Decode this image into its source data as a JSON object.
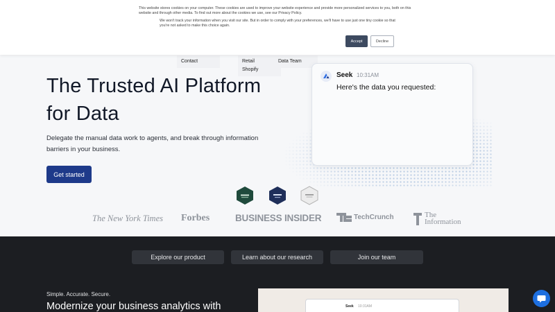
{
  "cookie": {
    "text1": "This website stores cookies on your computer. These cookies are used to improve your website experience and provide more personalized services to you, both on this website and through other media. To find out more about the cookies we use, see our Privacy Policy.",
    "text2": "We won't track your information when you visit our site. But in order to comply with your preferences, we'll have to use just one tiny cookie so that you're not asked to make this choice again.",
    "accept": "Accept",
    "decline": "Decline"
  },
  "nav_dropdowns": {
    "contact": "Contact",
    "retail": "Retail",
    "shopify": "Shopify",
    "data_team": "Data Team"
  },
  "hero": {
    "title_line1": "The Trusted AI Platform",
    "title_line2": "for Data",
    "subtitle": "Delegate the manual data work to agents, and break through information barriers in your business.",
    "cta": "Get started"
  },
  "chat": {
    "name": "Seek",
    "time": "10:31AM",
    "message": "Here's the data you requested:"
  },
  "badges": [
    {
      "icon": "g2-award-badge",
      "color": "#1f4a3c"
    },
    {
      "icon": "gartner-badge",
      "color": "#1f2f5a"
    },
    {
      "icon": "award-badge",
      "color": "#e8e8e8"
    }
  ],
  "press_logos": {
    "nyt": "The New York Times",
    "forbes": "Forbes",
    "business_insider": "BUSINESS INSIDER",
    "techcrunch": "TechCrunch",
    "the_information_line1": "The",
    "the_information_line2": "Information"
  },
  "dark_section": {
    "buttons": [
      "Explore our product",
      "Learn about our research",
      "Join our team"
    ],
    "kicker": "Simple. Accurate. Secure.",
    "title": "Modernize your business analytics with",
    "preview_name": "Seek",
    "preview_time": "10:31AM"
  },
  "colors": {
    "primary": "#1e3a8a",
    "dark_bg": "#1c1e22",
    "pill_bg": "#31343a",
    "help_button": "#1d6fe0"
  }
}
